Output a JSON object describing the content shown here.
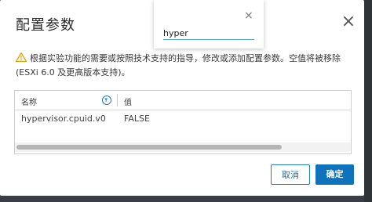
{
  "dialog": {
    "title": "配置参数",
    "close_glyph": "×",
    "warning_text": "根据实验功能的需要或按照技术支持的指导，修改或添加配置参数。空值将被移除 (ESXi 6.0 及更高版本支持)。",
    "warning_icon": "warning-triangle-icon",
    "accent_color": "#0f72bd",
    "warning_color": "#e8a000"
  },
  "grid": {
    "columns": [
      {
        "label": "名称"
      },
      {
        "label": "值"
      }
    ],
    "rows": [
      {
        "name": "hypervisor.cpuid.v0",
        "value": "FALSE"
      }
    ],
    "filter_icon": "filter-icon"
  },
  "search_popup": {
    "close_glyph": "×",
    "value": "hyper"
  },
  "buttons": {
    "cancel": "取消",
    "ok": "确定"
  }
}
